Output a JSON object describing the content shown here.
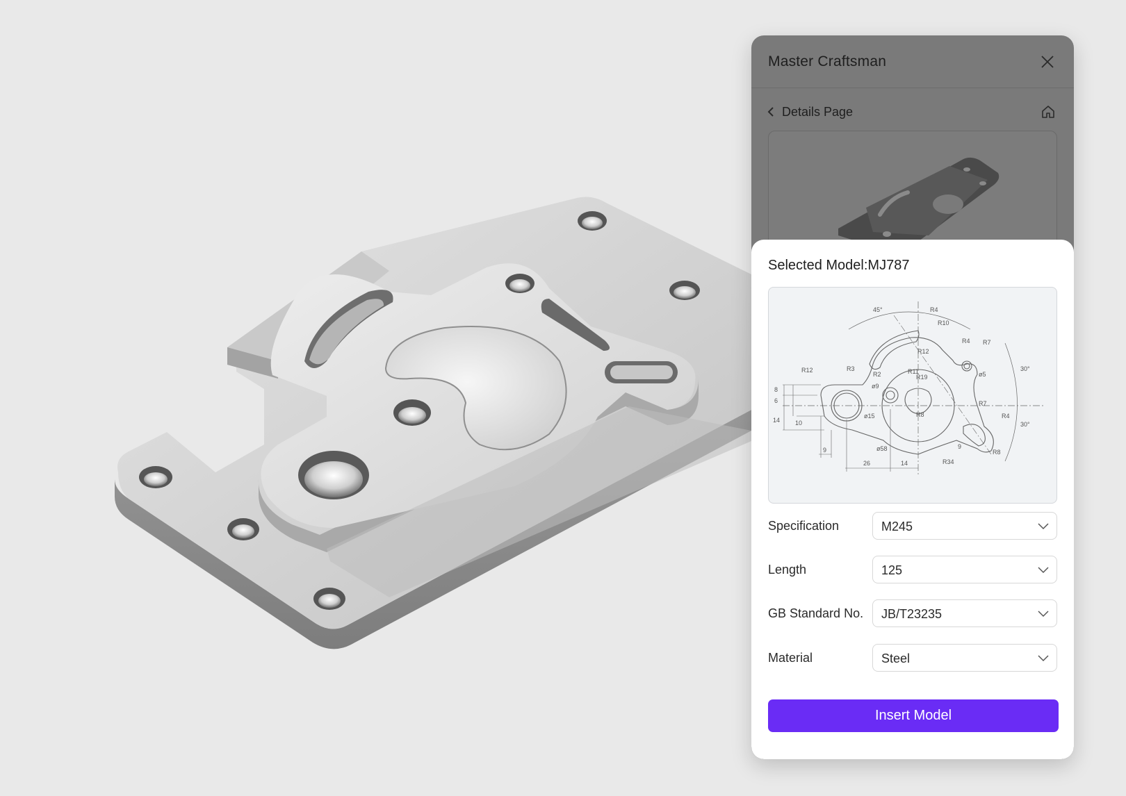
{
  "panel": {
    "title": "Master Craftsman",
    "back_label": "Details Page"
  },
  "sheet": {
    "selected_model": "Selected Model:MJ787",
    "fields": [
      {
        "label": "Specification",
        "value": "M245"
      },
      {
        "label": "Length",
        "value": "125"
      },
      {
        "label": "GB Standard No.",
        "value": "JB/T23235"
      },
      {
        "label": "Material",
        "value": "Steel"
      }
    ],
    "insert_label": "Insert Model"
  },
  "drawing_labels": {
    "a45": "45°",
    "r4a": "R4",
    "r10": "R10",
    "r4b": "R4",
    "r7a": "R7",
    "r12a": "R12",
    "r12b": "R12",
    "r3": "R3",
    "r2": "R2",
    "r11": "R11",
    "r19": "R19",
    "d9": "ø9",
    "d5": "ø5",
    "a30a": "30°",
    "a30b": "30°",
    "r7b": "R7",
    "r4c": "R4",
    "r8a": "R8",
    "d15": "ø15",
    "d58": "ø58",
    "n8": "8",
    "n6": "6",
    "n14a": "14",
    "n10": "10",
    "n9a": "9",
    "n26": "26",
    "n14b": "14",
    "r34": "R34",
    "n9b": "9",
    "r8b": "R8"
  },
  "colors": {
    "accent": "#6a2cf5",
    "overlay": "#7a7a7a",
    "sheet": "#ffffff"
  }
}
